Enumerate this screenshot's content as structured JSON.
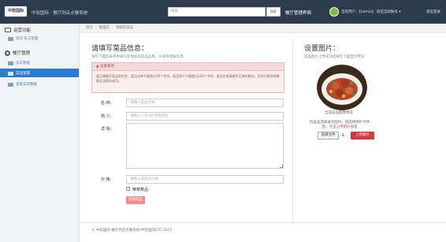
{
  "header": {
    "logo": "中软国际",
    "title": "中软国际 · 餐厅到店点餐系统",
    "search_placeholder": "搜索",
    "search_button": "搜索",
    "admin_label": "餐厅管理界面",
    "user_text": "当前用户：【admin】 退出当前账号 ▾",
    "logout": "退出登录"
  },
  "sidebar": {
    "section1": {
      "label": "运营功能",
      "items": [
        {
          "label": "首页·员工管理"
        }
      ]
    },
    "section2": {
      "label": "餐厅管理",
      "items": [
        {
          "label": "员工管理"
        },
        {
          "label": "菜品管理",
          "active": true
        },
        {
          "label": "查看菜单数据"
        }
      ]
    }
  },
  "breadcrumb": [
    "首页",
    "管理员",
    "添加新菜品"
  ],
  "form": {
    "title": "请填写菜品信息：",
    "subtitle": "请在下面的表单中填写新增加的菜品名称、价格等相关信息",
    "notice_title": "注意事项",
    "notice_body": "请正确填写菜品的信息，菜品名称不要超过20个字符，菜品简介不要超过200个字符，菜品价格请填写正确的数字，否则可能导致数据无法保存成功。",
    "fields": [
      {
        "label": "名  称:",
        "placeholder": "请输入菜品名称"
      },
      {
        "label": "简  介:",
        "placeholder": "请输入少于100字的简介"
      },
      {
        "label": "详  情:",
        "placeholder": ""
      },
      {
        "label": "价  格:",
        "placeholder": "请输入菜品的价格"
      }
    ],
    "recommend_label": "推荐菜品",
    "recommend_checked": false,
    "submit": "添加菜品"
  },
  "image_panel": {
    "title": "设置图片：",
    "subtitle": "菜品图片上传成功后将在下面显示预览",
    "caption": "当前菜品图像预览",
    "note_line1": "为菜品选择展示图片，请选择图片文件",
    "note_line2_pre": "后，点击",
    "note_line2_hl": "上传图片",
    "note_line2_post": "按钮",
    "choose_button": "选择文件",
    "none_label": "未",
    "upload_button": "上传图片"
  },
  "footer": "© 中软国际·餐厅到店点餐系统·中软国际ETC 2015",
  "colors": {
    "topbar": "#2c3b4d",
    "sidebar_active": "#2a7bd0",
    "upload_button": "#d9363e",
    "submit_button": "#f28c8c"
  }
}
